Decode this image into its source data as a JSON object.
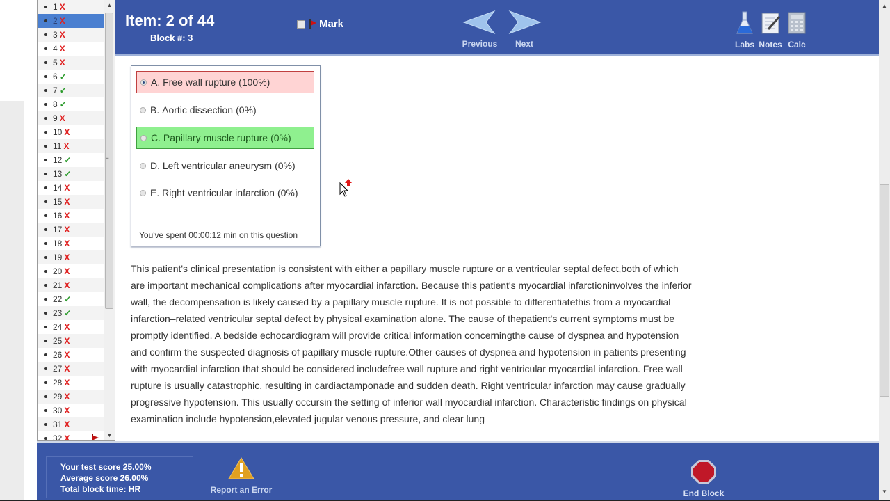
{
  "header": {
    "item_title": "Item: 2 of 44",
    "block_label": "Block #: 3",
    "mark_label": "Mark",
    "mark_checked": false,
    "previous_label": "Previous",
    "next_label": "Next",
    "tools": [
      {
        "label": "Labs",
        "icon": "flask-icon"
      },
      {
        "label": "Notes",
        "icon": "notepad-icon"
      },
      {
        "label": "Calc",
        "icon": "calculator-icon"
      }
    ]
  },
  "question_list": {
    "active": 2,
    "items": [
      {
        "num": "1",
        "status": "incorrect"
      },
      {
        "num": "2",
        "status": "incorrect"
      },
      {
        "num": "3",
        "status": "incorrect"
      },
      {
        "num": "4",
        "status": "incorrect"
      },
      {
        "num": "5",
        "status": "incorrect"
      },
      {
        "num": "6",
        "status": "correct"
      },
      {
        "num": "7",
        "status": "correct"
      },
      {
        "num": "8",
        "status": "correct"
      },
      {
        "num": "9",
        "status": "incorrect"
      },
      {
        "num": "10",
        "status": "incorrect"
      },
      {
        "num": "11",
        "status": "incorrect"
      },
      {
        "num": "12",
        "status": "correct"
      },
      {
        "num": "13",
        "status": "correct"
      },
      {
        "num": "14",
        "status": "incorrect"
      },
      {
        "num": "15",
        "status": "incorrect"
      },
      {
        "num": "16",
        "status": "incorrect"
      },
      {
        "num": "17",
        "status": "incorrect"
      },
      {
        "num": "18",
        "status": "incorrect"
      },
      {
        "num": "19",
        "status": "incorrect"
      },
      {
        "num": "20",
        "status": "incorrect"
      },
      {
        "num": "21",
        "status": "incorrect"
      },
      {
        "num": "22",
        "status": "correct"
      },
      {
        "num": "23",
        "status": "correct"
      },
      {
        "num": "24",
        "status": "incorrect"
      },
      {
        "num": "25",
        "status": "incorrect"
      },
      {
        "num": "26",
        "status": "incorrect"
      },
      {
        "num": "27",
        "status": "incorrect"
      },
      {
        "num": "28",
        "status": "incorrect"
      },
      {
        "num": "29",
        "status": "incorrect"
      },
      {
        "num": "30",
        "status": "incorrect"
      },
      {
        "num": "31",
        "status": "incorrect"
      },
      {
        "num": "32",
        "status": "incorrect",
        "flagged": true
      }
    ],
    "incorrect_glyph": "X",
    "correct_glyph": "✓"
  },
  "answers": {
    "options": [
      {
        "letter": "A.",
        "text": "Free wall rupture",
        "pct": "(100%)",
        "state": "selected-wrong"
      },
      {
        "letter": "B.",
        "text": "Aortic dissection",
        "pct": "(0%)",
        "state": "none"
      },
      {
        "letter": "C.",
        "text": "Papillary muscle rupture",
        "pct": "(0%)",
        "state": "correct"
      },
      {
        "letter": "D.",
        "text": "Left ventricular aneurysm",
        "pct": "(0%)",
        "state": "none"
      },
      {
        "letter": "E.",
        "text": "Right ventricular infarction",
        "pct": "(0%)",
        "state": "none"
      }
    ],
    "time_spent": "You've spent 00:00:12 min on this question"
  },
  "explanation": {
    "text": "This patient's clinical presentation is consistent with either a papillary muscle rupture or a ventricular septal defect,both of which are important mechanical complications after myocardial infarction. Because this patient's myocardial infarctioninvolves the inferior wall, the decompensation is likely caused by a papillary muscle rupture. It is not possible to differentiatethis from a myocardial infarction–related ventricular septal defect by physical examination alone. The cause of thepatient's current symptoms must be promptly identified. A bedside echocardiogram will provide critical information concerningthe cause of dyspnea and hypotension and confirm the suspected diagnosis of papillary muscle rupture.Other causes of dyspnea and hypotension in patients presenting with myocardial infarction that should be considered includefree wall rupture and right ventricular myocardial infarction. Free wall rupture is usually catastrophic, resulting in cardiactamponade and sudden death. Right ventricular infarction may cause gradually progressive hypotension. This usually occursin the setting of inferior wall myocardial infarction. Characteristic findings on physical examination include hypotension,elevated jugular venous pressure, and clear lung"
  },
  "footer": {
    "test_score": "Your test score 25.00%",
    "average_score": "Average score 26.00%",
    "block_time": "Total block time: HR",
    "report_label": "Report an Error",
    "end_block_label": "End Block"
  },
  "colors": {
    "header_bg": "#3a57a7",
    "correct_fill": "#8ff08f",
    "wrong_fill": "#ffd4d4",
    "active_row": "#4a7fd0",
    "incorrect_mark": "#e02020",
    "correct_mark": "#2a9a2a"
  }
}
